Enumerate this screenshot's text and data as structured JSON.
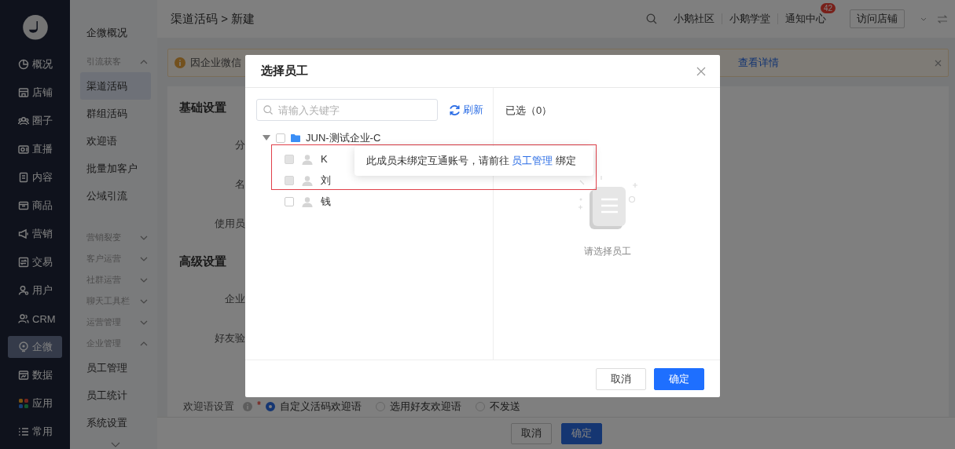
{
  "nav": {
    "items": [
      {
        "label": "概况",
        "selected": false
      },
      {
        "label": "店铺",
        "selected": false
      },
      {
        "label": "圈子",
        "selected": false
      },
      {
        "label": "直播",
        "selected": false
      },
      {
        "label": "内容",
        "selected": false
      },
      {
        "label": "商品",
        "selected": false
      },
      {
        "label": "营销",
        "selected": false
      },
      {
        "label": "交易",
        "selected": false
      },
      {
        "label": "用户",
        "selected": false
      },
      {
        "label": "CRM",
        "selected": false
      },
      {
        "label": "企微",
        "selected": true
      },
      {
        "label": "数据",
        "selected": false
      },
      {
        "label": "应用",
        "selected": false
      },
      {
        "label": "常用",
        "selected": false
      }
    ]
  },
  "subnav": {
    "items": [
      {
        "kind": "link",
        "label": "企微概况",
        "selected": false
      },
      {
        "kind": "group",
        "label": "引流获客",
        "expanded": true,
        "children": [
          {
            "label": "渠道活码",
            "selected": true
          },
          {
            "label": "群组活码",
            "selected": false
          },
          {
            "label": "欢迎语",
            "selected": false
          },
          {
            "label": "批量加客户",
            "selected": false
          },
          {
            "label": "公域引流",
            "selected": false
          }
        ]
      },
      {
        "kind": "group",
        "label": "营销裂变",
        "expanded": false
      },
      {
        "kind": "group",
        "label": "客户运营",
        "expanded": false
      },
      {
        "kind": "group",
        "label": "社群运营",
        "expanded": false
      },
      {
        "kind": "group",
        "label": "聊天工具栏",
        "expanded": false
      },
      {
        "kind": "group",
        "label": "运营管理",
        "expanded": false
      },
      {
        "kind": "group",
        "label": "企业管理",
        "expanded": true,
        "children": [
          {
            "label": "员工管理",
            "selected": false
          },
          {
            "label": "员工统计",
            "selected": false
          },
          {
            "label": "系统设置",
            "selected": false
          }
        ]
      }
    ]
  },
  "header": {
    "breadcrumb": "渠道活码 > 新建",
    "links": [
      "小鹅社区",
      "小鹅学堂"
    ],
    "notification": {
      "label": "通知中心",
      "badge": "42"
    },
    "visit_button": "访问店铺"
  },
  "alert": {
    "text": "因企业微信",
    "link": "查看详情"
  },
  "form": {
    "sections": [
      {
        "title": "基础设置",
        "fields": [
          "分",
          "名",
          "使用员"
        ]
      },
      {
        "title": "高级设置",
        "fields": [
          "企业",
          "好友验"
        ]
      }
    ],
    "welcome": {
      "label": "欢迎语设置",
      "required": true,
      "options": [
        {
          "label": "自定义活码欢迎语",
          "selected": true
        },
        {
          "label": "选用好友欢迎语",
          "selected": false
        },
        {
          "label": "不发送",
          "selected": false
        }
      ]
    }
  },
  "footer": {
    "buttons": [
      "取消",
      "确定"
    ]
  },
  "modal": {
    "title": "选择员工",
    "search": {
      "placeholder": "请输入关键字"
    },
    "refresh": "刷新",
    "tree": [
      {
        "label": "JUN-测试企业-C",
        "expanded": true,
        "checked": false,
        "children": [
          {
            "label": "K",
            "disabled": true,
            "checked": false
          },
          {
            "label": "刘",
            "disabled": true,
            "checked": false
          },
          {
            "label": "钱",
            "disabled": false,
            "checked": false
          }
        ]
      }
    ],
    "tooltip": {
      "text": "此成员未绑定互通账号，请前往",
      "link": "员工管理",
      "suffix": "绑定"
    },
    "selected_title": "已选（0）",
    "empty_text": "请选择员工",
    "buttons": [
      "取消",
      "确定"
    ]
  }
}
